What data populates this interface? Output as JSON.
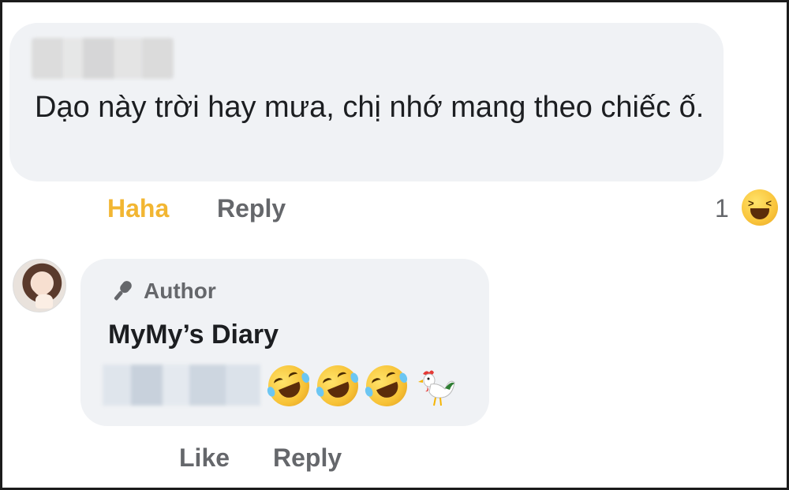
{
  "comment1": {
    "text": "Dạo này trời hay mưa, chị nhớ mang theo chiếc ố.",
    "actions": {
      "reaction_label": "Haha",
      "reply_label": "Reply"
    },
    "reaction": {
      "count": "1",
      "icon": "haha-reaction-icon"
    }
  },
  "comment2": {
    "badge_label": "Author",
    "badge_icon": "microphone-icon",
    "author_name": "MyMy’s Diary",
    "emojis": [
      "rolling-on-floor-laughing-emoji",
      "rolling-on-floor-laughing-emoji",
      "rolling-on-floor-laughing-emoji",
      "rooster-emoji"
    ],
    "actions": {
      "like_label": "Like",
      "reply_label": "Reply"
    }
  },
  "colors": {
    "bubble": "#f0f2f5",
    "haha": "#f2b632",
    "action_gray": "#65676b",
    "text": "#1c1e21"
  }
}
